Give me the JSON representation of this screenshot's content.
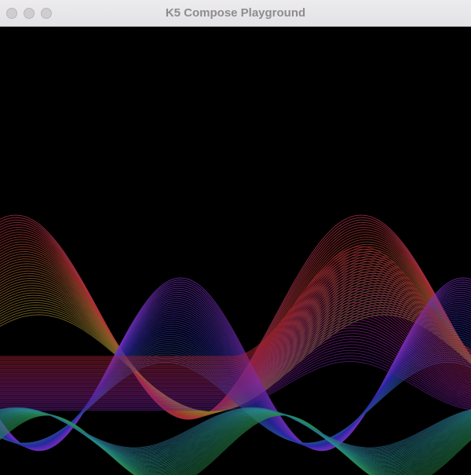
{
  "window": {
    "title": "K5 Compose Playground",
    "background": "#000000"
  },
  "titlebar": {
    "buttons": [
      {
        "name": "close-button",
        "icon": "circle-icon"
      },
      {
        "name": "minimize-button",
        "icon": "circle-icon"
      },
      {
        "name": "zoom-button",
        "icon": "circle-icon"
      }
    ]
  },
  "visualization": {
    "description_colors": [
      "#b03a3a",
      "#8a3ad0",
      "#5a3ad8",
      "#2f9a98",
      "#c0a020"
    ],
    "wave_count": 42
  }
}
